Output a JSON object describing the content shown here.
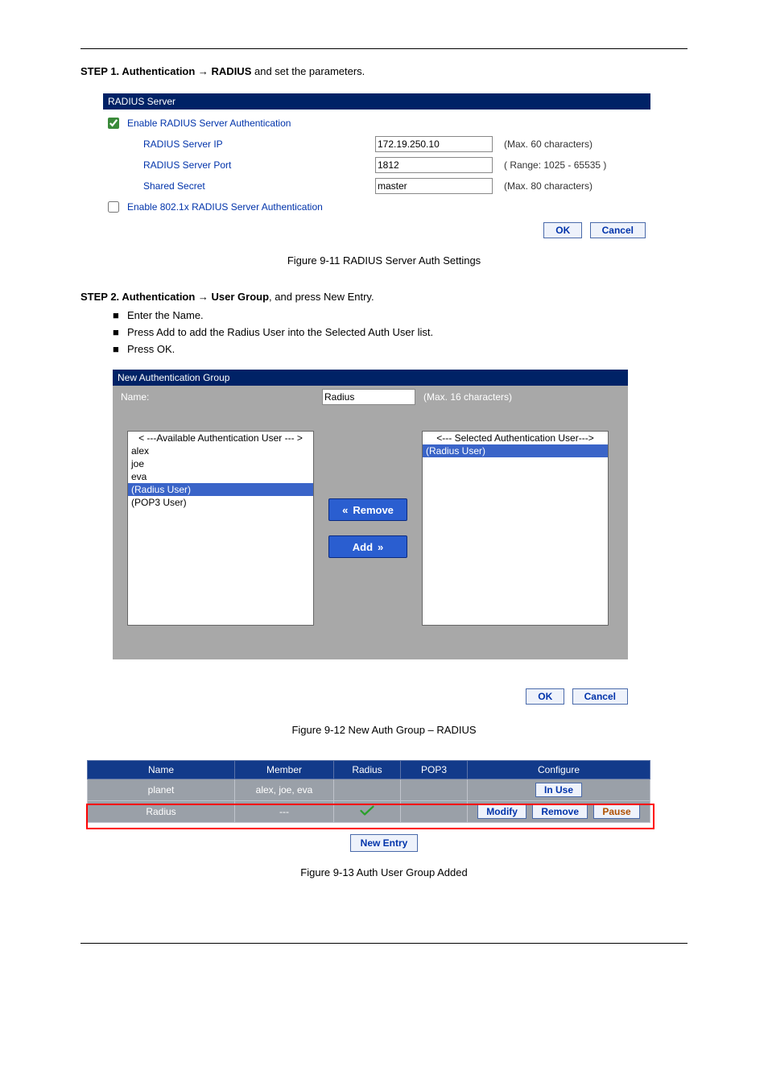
{
  "step1": {
    "text_prefix": "STEP 1. ",
    "path": "Authentication → RADIUS",
    "tail": " and set the parameters."
  },
  "radius": {
    "title": "RADIUS Server",
    "enable_label": "Enable RADIUS Server Authentication",
    "ip_label": "RADIUS Server IP",
    "ip_value": "172.19.250.10",
    "ip_hint": "(Max. 60 characters)",
    "port_label": "RADIUS Server Port",
    "port_value": "1812",
    "port_hint": "( Range: 1025 - 65535 )",
    "secret_label": "Shared Secret",
    "secret_value": "master",
    "secret_hint": "(Max. 80 characters)",
    "enable8021x_label": "Enable 802.1x RADIUS Server Authentication",
    "ok": "OK",
    "cancel": "Cancel"
  },
  "fig1": "Figure 9-11 RADIUS Server Auth Settings",
  "step2": {
    "text_prefix": "STEP 2. ",
    "path": "Authentication → User Group",
    "tail": ", and press New Entry.",
    "bullets": [
      "Enter the Name.",
      "Press Add to add the Radius User into the Selected Auth User list.",
      "Press OK."
    ]
  },
  "group": {
    "title": "New Authentication Group",
    "name_label": "Name:",
    "name_value": "Radius",
    "name_hint": "(Max. 16 characters)",
    "avail_header": "< ---Available Authentication User --- >",
    "avail_items": [
      "alex",
      "joe",
      "eva",
      "(Radius User)",
      "(POP3 User)"
    ],
    "avail_selected_index": 3,
    "sel_header": "<--- Selected Authentication User--->",
    "sel_items": [
      "(Radius User)"
    ],
    "sel_selected_index": 0,
    "remove": "Remove",
    "add": "Add",
    "ok": "OK",
    "cancel": "Cancel"
  },
  "fig2": "Figure 9-12 New Auth Group – RADIUS",
  "table": {
    "headers": [
      "Name",
      "Member",
      "Radius",
      "POP3",
      "Configure"
    ],
    "rows": [
      {
        "name": "planet",
        "member": "alex, joe, eva",
        "radius": "",
        "pop3": "",
        "config_type": "inuse"
      },
      {
        "name": "Radius",
        "member": "---",
        "radius": "check",
        "pop3": "",
        "config_type": "actions"
      }
    ],
    "inuse": "In  Use",
    "modify": "Modify",
    "remove": "Remove",
    "pause": "Pause",
    "new_entry": "New  Entry"
  },
  "fig3": "Figure 9-13 Auth User Group Added"
}
